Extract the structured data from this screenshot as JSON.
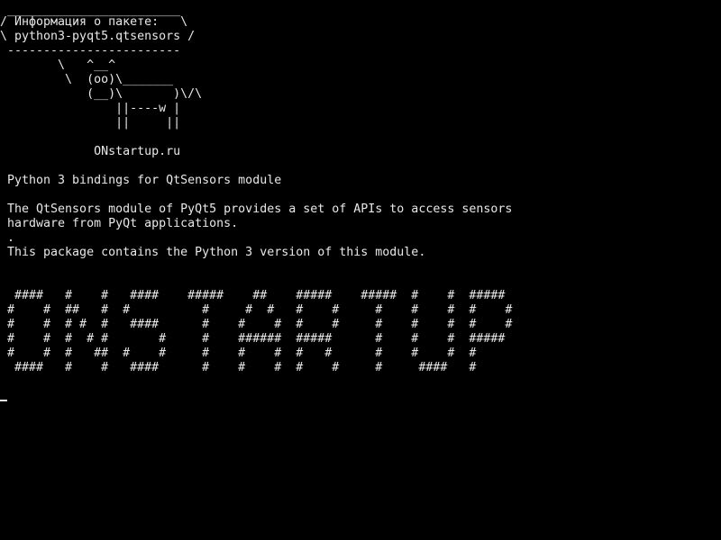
{
  "terminal": {
    "speech_bubble": [
      " ________________________",
      "/ Информация о пакете:   \\",
      "\\ python3-pyqt5.qtsensors /",
      " ------------------------"
    ],
    "cow": [
      "        \\   ^__^",
      "         \\  (oo)\\_______",
      "            (__)\\       )\\/\\",
      "                ||----w |",
      "                ||     ||"
    ],
    "site_label": "             ONstartup.ru",
    "summary": " Python 3 bindings for QtSensors module",
    "description": [
      " The QtSensors module of PyQt5 provides a set of APIs to access sensors",
      " hardware from PyQt applications.",
      " .",
      " This package contains the Python 3 version of this module."
    ],
    "banner": [
      "  ####   #    #   ####    #####    ##    #####    #####  #    #  #####",
      " #    #  ##   #  #          #     #  #   #    #     #    #    #  #    #",
      " #    #  # #  #   ####      #    #    #  #    #     #    #    #  #    #",
      " #    #  #  # #       #     #    ######  #####      #    #    #  #####",
      " #    #  #   ##  #    #     #    #    #  #   #      #    #    #  #",
      "  ####   #    #   ####      #    #    #  #    #     #     ####   #"
    ],
    "colors": {
      "background": "#000000",
      "foreground": "#e8e8e8"
    }
  }
}
